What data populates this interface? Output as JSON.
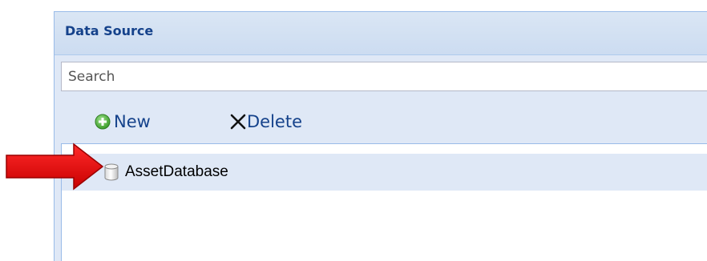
{
  "panel": {
    "title": "Data Source"
  },
  "search": {
    "placeholder": "Search",
    "value": ""
  },
  "toolbar": {
    "new_label": "New",
    "delete_label": "Delete"
  },
  "tree": {
    "items": [
      {
        "label": "AssetDatabase",
        "icon": "database-icon",
        "selected": true
      }
    ]
  },
  "annotation": {
    "arrow_icon": "red-arrow-icon",
    "arrow_color": "#e00000"
  },
  "colors": {
    "header_text": "#15428b",
    "panel_bg": "#dfe8f6",
    "border": "#99bbe8",
    "add_green": "#4cae3a"
  }
}
